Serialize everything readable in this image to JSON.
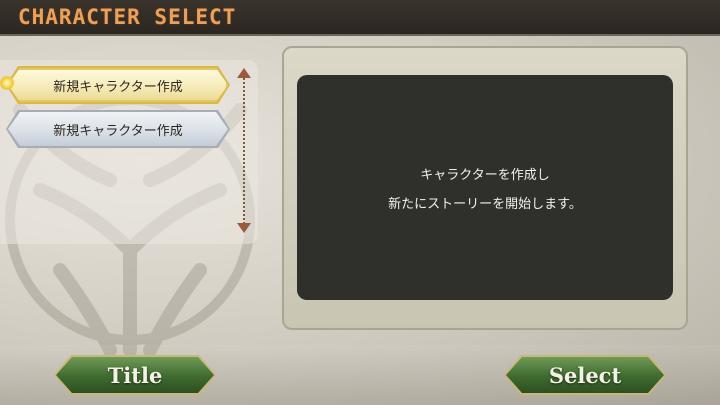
{
  "header": {
    "title": "CHARACTER SELECT"
  },
  "slots": [
    {
      "label": "新規キャラクター作成",
      "state": "selected"
    },
    {
      "label": "新規キャラクター作成",
      "state": "normal"
    }
  ],
  "description": {
    "line1": "キャラクターを作成し",
    "line2": "新たにストーリーを開始します。"
  },
  "buttons": {
    "title": "Title",
    "select": "Select"
  },
  "colors": {
    "header_text": "#e9a15b",
    "selected_slot": "#f5e9b5",
    "button_green": "#3f6a2f",
    "panel_dark": "#2f302b"
  },
  "icons": [
    "scroll-up-arrow-icon",
    "scroll-down-arrow-icon",
    "selector-dot-icon",
    "emblem-icon"
  ]
}
